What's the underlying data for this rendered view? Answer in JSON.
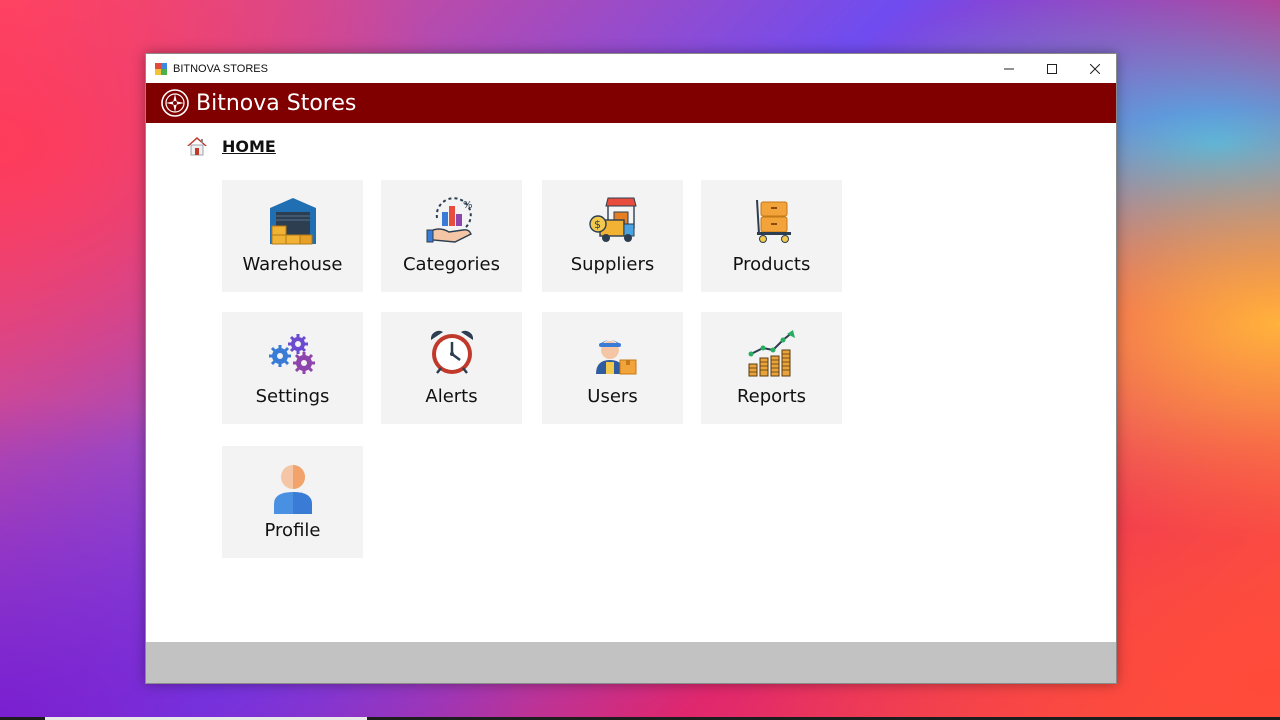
{
  "window": {
    "title": "BITNOVA STORES",
    "controls": {
      "minimize": "—",
      "maximize": "☐",
      "close": "✕"
    }
  },
  "header": {
    "brand": "Bitnova Stores",
    "color": "#800000"
  },
  "breadcrumb": {
    "label": "HOME"
  },
  "tiles": [
    {
      "label": "Warehouse",
      "icon": "warehouse-icon"
    },
    {
      "label": "Categories",
      "icon": "categories-icon"
    },
    {
      "label": "Suppliers",
      "icon": "suppliers-icon"
    },
    {
      "label": "Products",
      "icon": "products-icon"
    },
    {
      "label": "Settings",
      "icon": "settings-icon"
    },
    {
      "label": "Alerts",
      "icon": "alerts-icon"
    },
    {
      "label": "Users",
      "icon": "users-icon"
    },
    {
      "label": "Reports",
      "icon": "reports-icon"
    },
    {
      "label": "Profile",
      "icon": "profile-icon"
    }
  ]
}
